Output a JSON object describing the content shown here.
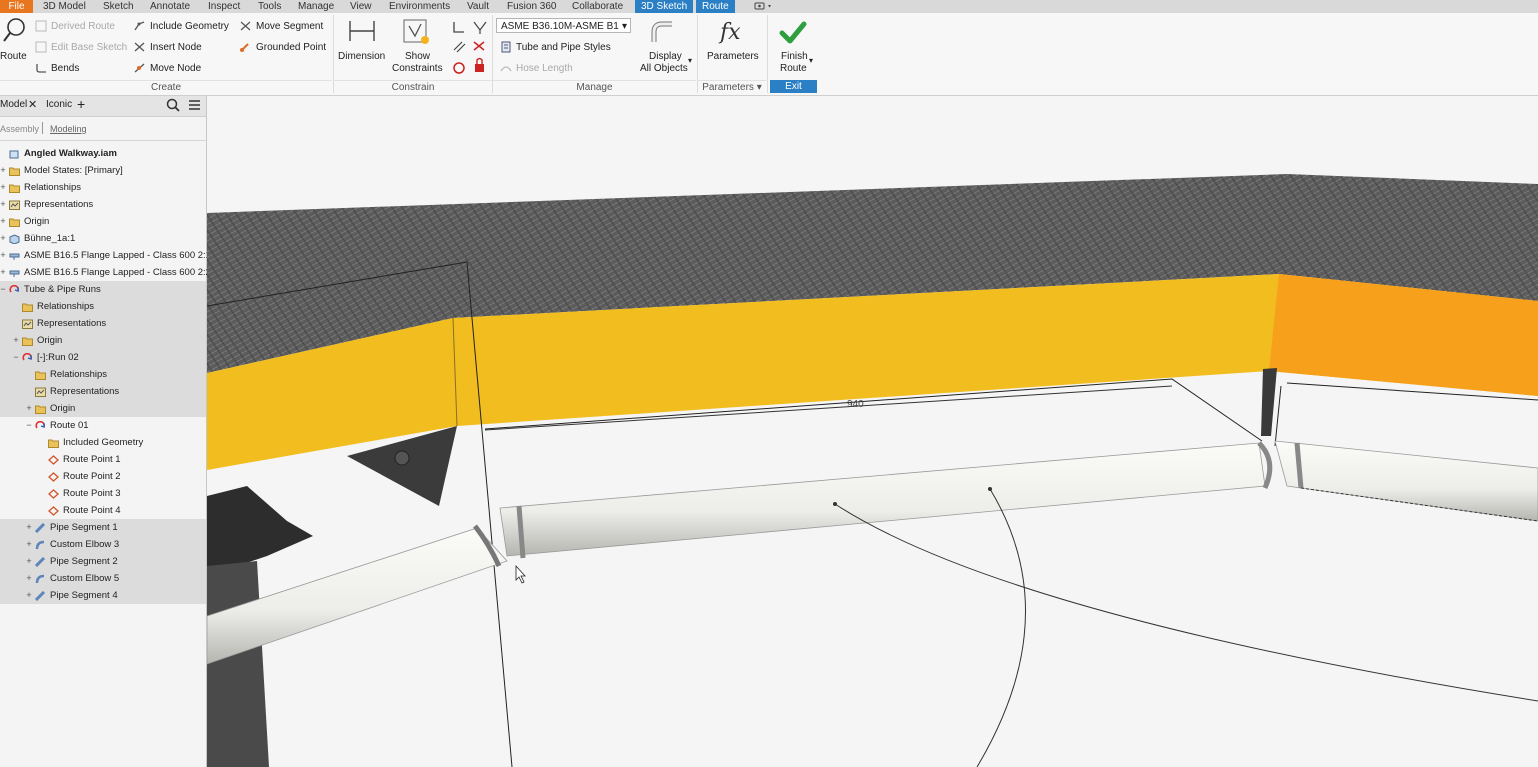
{
  "menubar": {
    "items": [
      "File",
      "3D Model",
      "Sketch",
      "Annotate",
      "Inspect",
      "Tools",
      "Manage",
      "View",
      "Environments",
      "Vault",
      "Fusion 360",
      "Collaborate",
      "3D Sketch",
      "Route"
    ]
  },
  "ribbon": {
    "route": "Route",
    "derived_route": "Derived Route",
    "edit_base_sketch": "Edit Base Sketch",
    "bends": "Bends",
    "include_geometry": "Include Geometry",
    "insert_node": "Insert Node",
    "move_node": "Move Node",
    "move_segment": "Move Segment",
    "grounded_point": "Grounded Point",
    "create_panel": "Create",
    "dimension": "Dimension",
    "show": "Show",
    "constraints": "Constraints",
    "constrain_panel": "Constrain",
    "style_value": "ASME B36.10M-ASME B1",
    "tube_pipe_styles": "Tube and Pipe Styles",
    "hose_length": "Hose Length",
    "manage_panel": "Manage",
    "display": "Display",
    "all_objects": "All Objects",
    "parameters": "Parameters",
    "parameters_panel": "Parameters",
    "finish": "Finish",
    "route2": "Route",
    "exit_panel": "Exit"
  },
  "sidebar": {
    "tab_model": "Model",
    "tab_iconic": "Iconic",
    "filter_assembly": "Assembly",
    "filter_modeling": "Modeling",
    "tree": [
      "Angled Walkway.iam",
      "Model States: [Primary]",
      "Relationships",
      "Representations",
      "Origin",
      "Bühne_1a:1",
      "ASME B16.5 Flange Lapped - Class 600 2:1",
      "ASME B16.5 Flange Lapped - Class 600 2:2",
      "Tube & Pipe Runs",
      "Relationships",
      "Representations",
      "Origin",
      "[-]:Run 02",
      "Relationships",
      "Representations",
      "Origin",
      "Route 01",
      "Included Geometry",
      "Route Point 1",
      "Route Point 2",
      "Route Point 3",
      "Route Point 4",
      "Pipe Segment 1",
      "Custom Elbow 3",
      "Pipe Segment 2",
      "Custom Elbow 5",
      "Pipe Segment 4"
    ]
  },
  "viewport": {
    "dimension_value": "940"
  },
  "colors": {
    "accent": "#2a7fc5",
    "file_tab": "#e8761f",
    "beam": "#f2bd1e",
    "grating": "#5a5a5a",
    "finish_check": "#2e9e3e"
  }
}
